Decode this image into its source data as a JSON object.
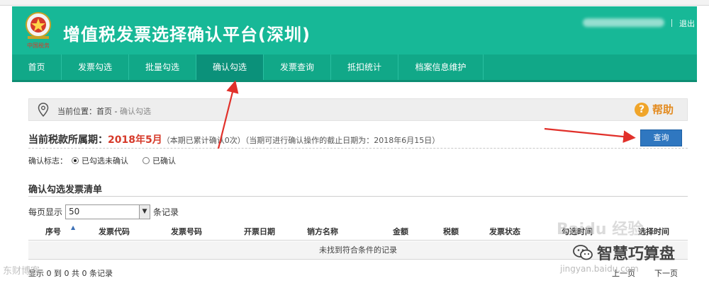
{
  "header": {
    "title": "增值税发票选择确认平台(深圳)",
    "logout_label": "退出",
    "emblem_caption": "中国税务"
  },
  "nav": {
    "items": [
      {
        "label": "首页"
      },
      {
        "label": "发票勾选"
      },
      {
        "label": "批量勾选"
      },
      {
        "label": "确认勾选"
      },
      {
        "label": "发票查询"
      },
      {
        "label": "抵扣统计"
      },
      {
        "label": "档案信息维护"
      }
    ],
    "active_index": 3
  },
  "breadcrumb": {
    "prefix": "当前位置：首页 - ",
    "current": "确认勾选"
  },
  "help": {
    "icon": "question-icon",
    "label": "帮助"
  },
  "period": {
    "label": "当前税款所属期：",
    "value": "2018年5月",
    "note": "（本期已累计确认0次）（当期可进行确认操作的截止日期为：2018年6月15日）"
  },
  "query_button": {
    "label": "查询"
  },
  "confirm_flag": {
    "label": "确认标志：",
    "options": [
      {
        "label": "已勾选未确认",
        "selected": true
      },
      {
        "label": "已确认",
        "selected": false
      }
    ]
  },
  "list": {
    "title": "确认勾选发票清单",
    "pagesize_prefix": "每页显示",
    "pagesize_value": "50",
    "pagesize_suffix": "条记录",
    "columns": [
      "序号",
      "发票代码",
      "发票号码",
      "开票日期",
      "销方名称",
      "金额",
      "税额",
      "发票状态",
      "勾选时间",
      "选择时间"
    ],
    "empty_message": "未找到符合条件的记录",
    "footer_info": "显示 0 到 0 共 0 条记录",
    "prev_label": "上一页",
    "next_label": "下一页"
  },
  "watermarks": {
    "baidu": "Baidu 经验",
    "brand": "智慧巧算盘",
    "jingyan": "jingyan.baidu.com",
    "left": "东财博客"
  },
  "colors": {
    "header_green": "#17b897",
    "nav_green": "#11a888",
    "period_red": "#d63a2a",
    "query_blue": "#2f77c0",
    "annotation_red": "#e1302a",
    "help_orange": "#f0a52a"
  }
}
